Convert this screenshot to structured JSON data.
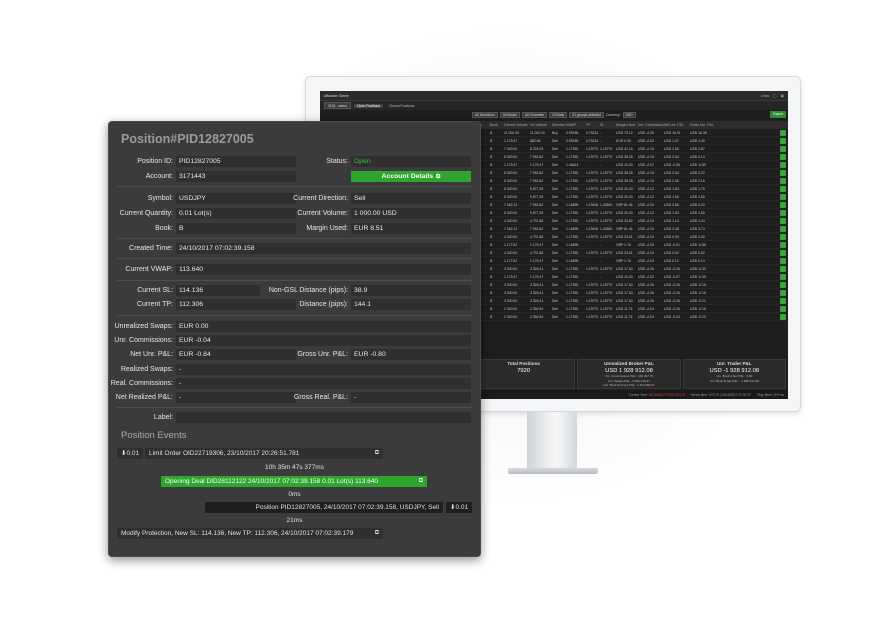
{
  "monitor_screen": {
    "title": "cBroker Gene",
    "top_right": [
      "Links",
      "▢",
      "▣"
    ],
    "account_select": "3101 - demo",
    "tabs": [
      "Open Positions",
      "Closed Positions"
    ],
    "filters": [
      "All Directions",
      "All Books",
      "All Channels",
      "Of Book",
      "21 groups selected",
      "Currency:",
      "USD"
    ],
    "export_label": "Export",
    "columns": [
      "Position",
      "Book",
      "Current Volume",
      "Vol Volume",
      "Direction",
      "VWAP",
      "TP",
      "SL",
      "Margin Used",
      "Unr. Commissions",
      "Net Unr. P&L",
      "Gross Unr. P&L"
    ],
    "rows": [
      [
        "...USD",
        "B",
        "11 000.00",
        "11 000.00",
        "Buy",
        "0.99188",
        "0.70131",
        "-",
        "USD 79.12",
        "USD -0.39",
        "USD 16.91",
        "USD 16.38"
      ],
      [
        "...USD",
        "B",
        "1 175.47",
        "882.46",
        "Sell",
        "0.99188",
        "0.70131",
        "-",
        "EUR 0.39",
        "USD -0.02",
        "USD 1.47",
        "USD 1.49"
      ],
      [
        "...USD",
        "B",
        "7 000.00",
        "8 225.29",
        "Sell",
        "1.17930",
        "1.19770",
        "1.19770",
        "USD 41.16",
        "USD -0.16",
        "USD 2.65",
        "USD 2.87"
      ],
      [
        "...USD",
        "B",
        "6 000.00",
        "7 052.62",
        "Sell",
        "1.17930",
        "1.19770",
        "1.19770",
        "USD 35.28",
        "USD -0.16",
        "USD 2.00",
        "USD 2.14"
      ],
      [
        "...USD",
        "B",
        "1 175.47",
        "1 175.47",
        "Sell",
        "1.46614",
        "-",
        "-",
        "USD 10.00",
        "USD -0.07",
        "USD -0.96",
        "USD -0.89"
      ],
      [
        "...USD",
        "B",
        "6 000.00",
        "7 052.62",
        "Sell",
        "1.17930",
        "1.19770",
        "1.19770",
        "USD 35.28",
        "USD -0.16",
        "USD 2.00",
        "USD 2.22"
      ],
      [
        "...USD",
        "B",
        "6 000.00",
        "7 052.62",
        "Sell",
        "1.17930",
        "1.19770",
        "1.19770",
        "USD 35.28",
        "USD -0.16",
        "USD 2.06",
        "USD 2.16"
      ],
      [
        "...USD",
        "B",
        "5 000.00",
        "5 877.35",
        "Sell",
        "1.17930",
        "1.19770",
        "1.19770",
        "USD 29.40",
        "USD -0.12",
        "USD 1.63",
        "USD 1.75"
      ],
      [
        "...USD",
        "B",
        "5 000.00",
        "5 877.35",
        "Sell",
        "1.17930",
        "1.19770",
        "1.19770",
        "USD 29.40",
        "USD -0.12",
        "USD 1.56",
        "USD 1.65"
      ],
      [
        "...USD",
        "B",
        "7 062.12",
        "7 052.62",
        "Sell",
        "1.16698",
        "1.19406",
        "1.40840",
        "GBP 61.46",
        "USD -0.34",
        "USD 3.86",
        "USD 4.20"
      ],
      [
        "...USD",
        "B",
        "5 000.00",
        "5 877.35",
        "Sell",
        "1.17930",
        "1.19770",
        "1.19770",
        "USD 29.40",
        "USD -0.12",
        "USD 1.53",
        "USD 1.65"
      ],
      [
        "...USD",
        "B",
        "4 000.00",
        "4 701.88",
        "Sell",
        "1.17930",
        "1.19770",
        "1.19770",
        "USD 23.52",
        "USD -0.10",
        "USD 1.14",
        "USD 1.24"
      ],
      [
        "...USD",
        "B",
        "7 062.12",
        "7 052.62",
        "Sell",
        "1.16698",
        "1.19406",
        "1.40840",
        "GBP 61.46",
        "USD -0.34",
        "USD 3.38",
        "USD 3.73"
      ],
      [
        "...USD",
        "B",
        "4 000.00",
        "4 701.88",
        "Sell",
        "1.17930",
        "1.19770",
        "1.19770",
        "USD 23.51",
        "USD -0.10",
        "USD 0.90",
        "USD 1.00"
      ],
      [
        "...USD",
        "B",
        "1 177.62",
        "1 175.47",
        "Sell",
        "1.16698",
        "-",
        "-",
        "GBP 1.76",
        "USD -0.05",
        "USD -0.91",
        "USD -0.86"
      ],
      [
        "...USD",
        "B",
        "4 000.00",
        "4 701.88",
        "Sell",
        "1.17930",
        "1.19770",
        "1.19770",
        "USD 23.51",
        "USD -0.10",
        "USD 0.92",
        "USD 0.92"
      ],
      [
        "...USD",
        "B",
        "1 177.62",
        "1 175.47",
        "Sell",
        "1.16698",
        "-",
        "-",
        "GBP 1.76",
        "USD -0.03",
        "USD 0.12",
        "USD 0.14"
      ],
      [
        "...USD",
        "B",
        "3 000.00",
        "3 526.41",
        "Sell",
        "1.17930",
        "1.19770",
        "1.19770",
        "USD 17.63",
        "USD -0.06",
        "USD -0.26",
        "USD -0.30"
      ],
      [
        "...USD",
        "B",
        "1 175.47",
        "1 175.47",
        "Sell",
        "1.17930",
        "-",
        "-",
        "USD 10.00",
        "USD -0.02",
        "USD -0.07",
        "USD -0.05"
      ],
      [
        "...USD",
        "B",
        "3 000.00",
        "3 526.41",
        "Sell",
        "1.17930",
        "1.19770",
        "1.19770",
        "USD 17.63",
        "USD -0.06",
        "USD -0.26",
        "USD -0.16"
      ],
      [
        "...USD",
        "B",
        "3 000.00",
        "3 526.41",
        "Sell",
        "1.17930",
        "1.19770",
        "1.19770",
        "USD 17.63",
        "USD -0.06",
        "USD -0.26",
        "USD -0.16"
      ],
      [
        "...USD",
        "B",
        "3 000.00",
        "3 526.41",
        "Sell",
        "1.17930",
        "1.19770",
        "1.19770",
        "USD 17.63",
        "USD -0.06",
        "USD -0.26",
        "USD -0.21"
      ],
      [
        "...USD",
        "B",
        "2 000.00",
        "2 350.94",
        "Sell",
        "1.17930",
        "1.19770",
        "1.19770",
        "USD 11.75",
        "USD -0.04",
        "USD -0.26",
        "USD -0.16"
      ],
      [
        "...USD",
        "B",
        "2 000.00",
        "2 350.94",
        "Sell",
        "1.17930",
        "1.19770",
        "1.19770",
        "USD 11.75",
        "USD -0.04",
        "USD -0.24",
        "USD -0.20"
      ]
    ],
    "summary": [
      {
        "title": "Total Positions",
        "value": "7920",
        "sub": []
      },
      {
        "title": "Unrealized Broker P&L",
        "value": "USD 1 928 912.08",
        "sub": [
          "Unr. Commissions P&L : 130 347.79",
          "Unr. Swaps P&L : 5 063 215.97",
          "Unr. Book B Gross P&L : 4 114 456.87"
        ]
      },
      {
        "title": "Unr. Trader P&L",
        "value": "USD -1 928 912.08",
        "sub": [
          "Unr. Book A Net P&L : 0.00",
          "Unr. Book B Net P&L : -1 928 912.08"
        ]
      }
    ],
    "status_bar": {
      "time_label": "Current Time:",
      "time_value": "24/10/2017 07:02 UTC+0",
      "server": "Server time: UTC+0 | 24/10/2017 07:02:37",
      "ping": "Ping 38ms | 9/9 ms"
    }
  },
  "panel": {
    "title": "Position#PID12827005",
    "position_id_label": "Position ID:",
    "position_id": "PID12827005",
    "status_label": "Status:",
    "status": "Open",
    "account_label": "Account:",
    "account": "3171443",
    "account_details_label": "Account Details",
    "symbol_label": "Symbol:",
    "symbol": "USDJPY",
    "current_direction_label": "Current Direction:",
    "current_direction": "Sell",
    "current_quantity_label": "Current Quantity:",
    "current_quantity": "0.01 Lot(s)",
    "current_volume_label": "Current Volume:",
    "current_volume": "1 000.00 USD",
    "book_label": "Book:",
    "book": "B",
    "margin_used_label": "Margin Used:",
    "margin_used": "EUR 8.51",
    "created_time_label": "Created Time:",
    "created_time": "24/10/2017 07:02:39.158",
    "current_vwap_label": "Current VWAP:",
    "current_vwap": "113.640",
    "current_sl_label": "Current SL:",
    "current_sl": "114.136",
    "non_gsl_label": "Non-GSL",
    "distance_sl_label": "Distance (pips):",
    "distance_sl": "38.9",
    "current_tp_label": "Current TP:",
    "current_tp": "112.306",
    "distance_tp_label": "Distance (pips):",
    "distance_tp": "144.1",
    "unrealized_swaps_label": "Unrealized Swaps:",
    "unrealized_swaps": "EUR 0.00",
    "unr_commissions_label": "Unr. Commissions:",
    "unr_commissions": "EUR -0.04",
    "net_unr_pl_label": "Net Unr. P&L:",
    "net_unr_pl": "EUR -0.84",
    "gross_unr_pl_label": "Gross Unr. P&L:",
    "gross_unr_pl": "EUR -0.80",
    "realized_swaps_label": "Realized Swaps:",
    "realized_swaps": "-",
    "real_commissions_label": "Real. Commissions:",
    "real_commissions": "-",
    "net_realized_pl_label": "Net Realized P&L:",
    "net_realized_pl": "-",
    "gross_real_pl_label": "Gross Real. P&L:",
    "gross_real_pl": "-",
    "label_label": "Label:",
    "label_value": "",
    "events_title": "Position Events",
    "events": {
      "limit_qty": "⬇0.01",
      "limit_order": "Limit Order OID22719306, 23/10/2017 20:26:51.781",
      "gap1": "10h 35m 47s 377ms",
      "opening_deal": "Opening Deal DID28112122 24/10/2017 07:02:39.158 0.01 Lot(s) 113.640",
      "gap2": "0ms",
      "position_event": "Position PID12827005, 24/10/2017 07:02:39.158, USDJPY, Sell",
      "position_qty": "⬇0.01",
      "gap3": "21ms",
      "modify_protection": "Modify Protection, New SL: 114.136, New TP: 112.306, 24/10/2017 07:02:39.179"
    }
  }
}
